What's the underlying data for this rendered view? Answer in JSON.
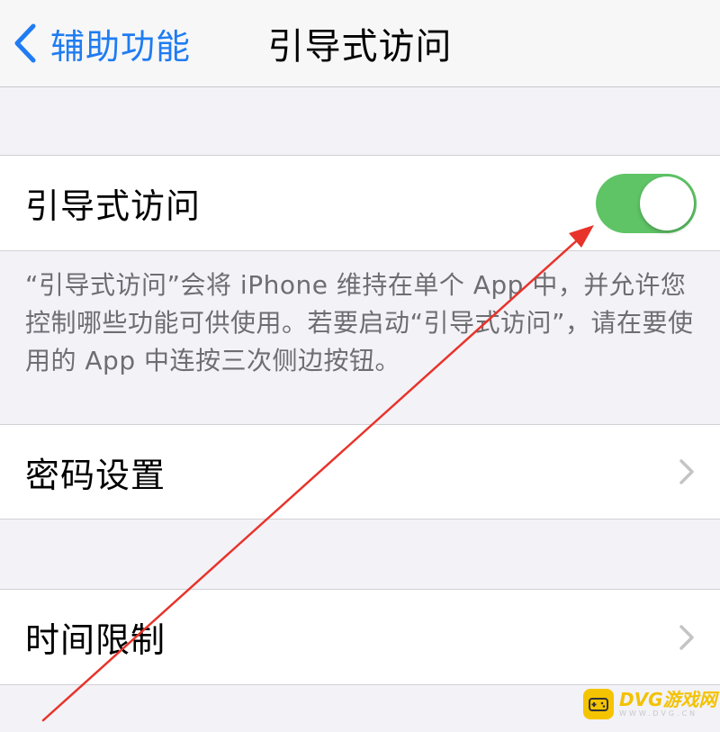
{
  "navbar": {
    "back_label": "辅助功能",
    "title": "引导式访问",
    "back_icon": "chevron-left-icon"
  },
  "guided_access": {
    "label": "引导式访问",
    "toggle_on": true,
    "toggle_color": "#5fc466"
  },
  "description": "“引导式访问”会将 iPhone 维持在单个 App 中，并允许您控制哪些功能可供使用。若要启动“引导式访问”，请在要使用的 App 中连按三次侧边按钮。",
  "passcode_settings": {
    "label": "密码设置",
    "icon": "chevron-right-icon"
  },
  "time_limits": {
    "label": "时间限制",
    "icon": "chevron-right-icon"
  },
  "annotation": {
    "arrow_color": "#e8332a"
  },
  "watermark": {
    "main": "DVG游戏网",
    "sub": "WWW.DVG.CN"
  },
  "colors": {
    "accent": "#1f7cf2",
    "background": "#f2f2f7"
  }
}
